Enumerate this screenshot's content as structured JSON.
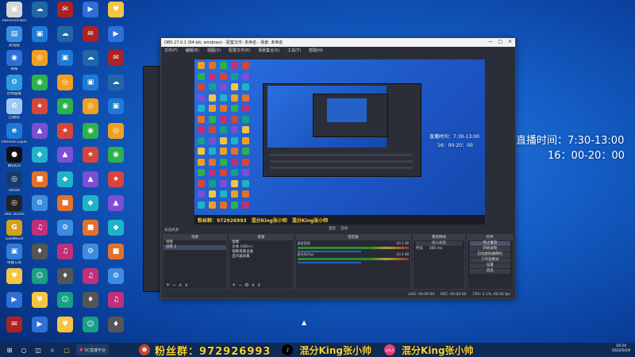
{
  "desktop_icons": [
    {
      "label": "Administrator",
      "color": "#d6d6d6",
      "glyph": "▣"
    },
    {
      "label": "此电脑",
      "color": "#3c8de0",
      "glyph": "▤"
    },
    {
      "label": "网络",
      "color": "#2e6fd8",
      "glyph": "◉"
    },
    {
      "label": "控制面板",
      "color": "#2c9be0",
      "glyph": "⚙"
    },
    {
      "label": "回收站",
      "color": "#9ec8ef",
      "glyph": "♻"
    },
    {
      "label": "Internet Explorer",
      "color": "#1e7ad6",
      "glyph": "e"
    },
    {
      "label": "腾讯QQ",
      "color": "#111111",
      "glyph": "●"
    },
    {
      "label": "Steam",
      "color": "#183a6b",
      "glyph": "◎"
    },
    {
      "label": "OBS Studio",
      "color": "#222222",
      "glyph": "◎"
    },
    {
      "label": "GoldWave",
      "color": "#d4a017",
      "glyph": "G"
    },
    {
      "label": "快捷方式",
      "color": "#2e7dd6",
      "glyph": "▣"
    }
  ],
  "overlay": {
    "schedule_title": "直播时间：7:30-13:00",
    "schedule_line2": "16：00-20：00"
  },
  "obs": {
    "title": "OBS 27.0.1 (64-bit, windows) - 配置文件: 未命名 - 场景: 未命名",
    "menu": [
      "文件(F)",
      "编辑(E)",
      "视图(V)",
      "配置文件(P)",
      "场景集合(S)",
      "工具(T)",
      "帮助(H)"
    ],
    "preview_status": [
      "混合",
      "活动"
    ],
    "scenes_header": "场景",
    "scenes": [
      "场景",
      "场景 2"
    ],
    "sources_header": "来源",
    "sources": [
      "图像",
      "文本 (GDI+)",
      "视频采集设备",
      "显示器采集"
    ],
    "mixer_header": "混音器",
    "mixer": [
      {
        "name": "桌面音频",
        "db": "-20.3 dB"
      },
      {
        "name": "麦克风/Aux",
        "db": "-20.3 dB"
      }
    ],
    "transition_header": "转场特效",
    "transition_value": "淡入淡出",
    "duration_label": "时长",
    "duration_value": "300 ms",
    "controls_header": "控件",
    "controls": [
      "停止推流",
      "开始录制",
      "启动虚拟摄像机",
      "工作室模式",
      "设置",
      "退出"
    ],
    "status": [
      "LIVE: 00:00:00",
      "REC: 00:00:00",
      "CPU: 2.1%, 60.00 fps"
    ],
    "scene_label": "未选择源",
    "preview_banner_fans": "粉丝群：972926993",
    "preview_banner_king1": "混分King张小帅",
    "preview_banner_king2": "混分King张小帅"
  },
  "taskbar": {
    "app_label": "SC直播平台",
    "fans_text": "粉丝群：972926993",
    "king_text_1": "混分King张小帅",
    "king_text_2": "混分King张小帅",
    "time": "10:24",
    "date": "2022/5/19"
  },
  "colors": {
    "accent_yellow": "#f7d23a",
    "obs_bg": "#2b2e38",
    "taskbar": "#0f2a55"
  }
}
